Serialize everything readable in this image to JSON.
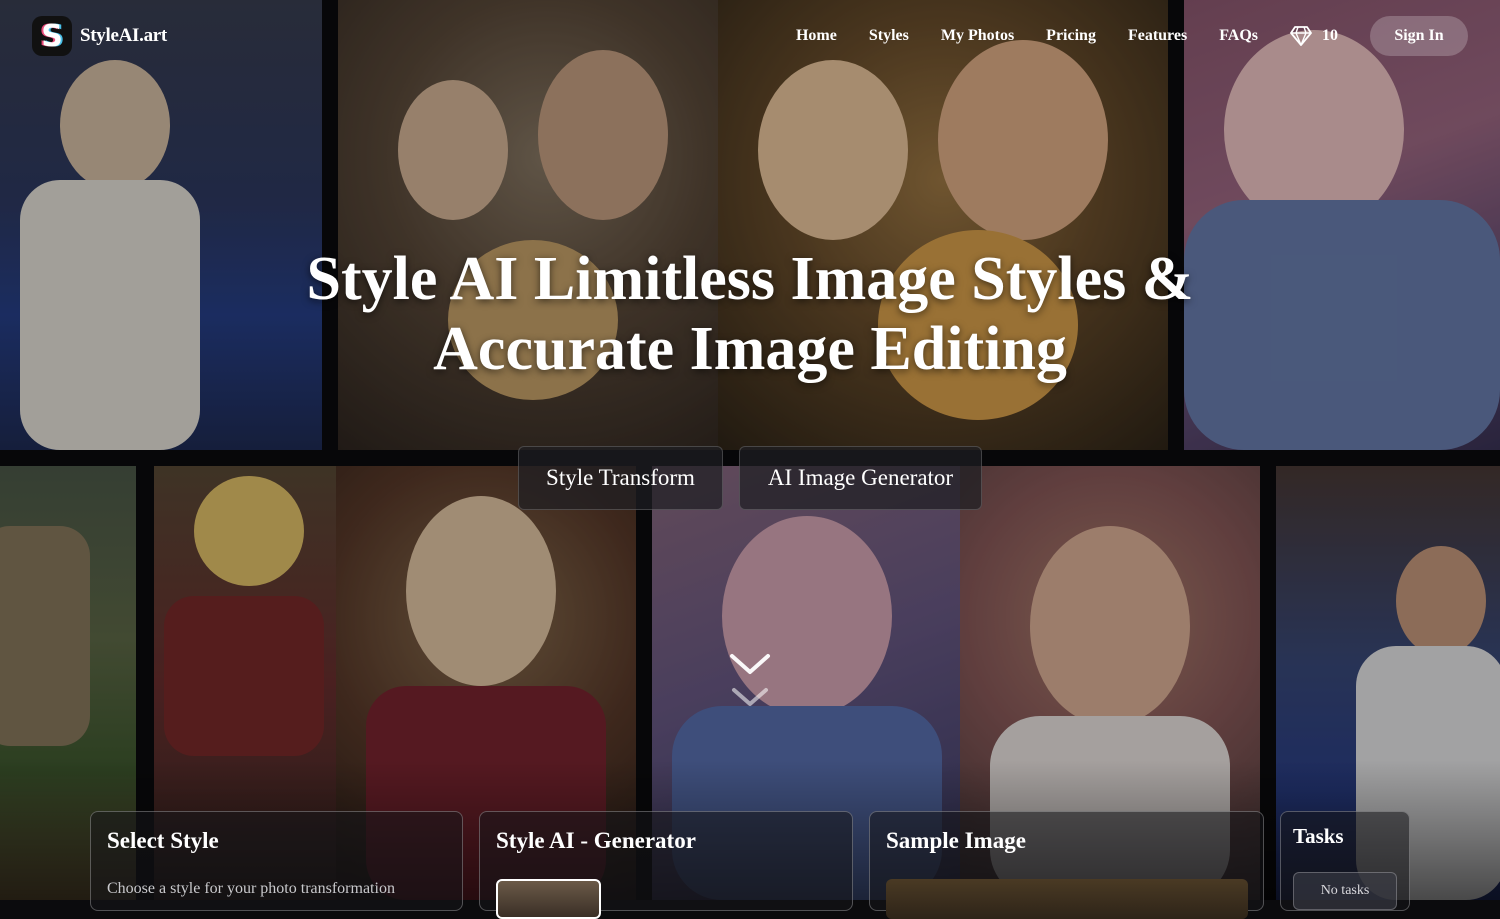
{
  "brand": {
    "name": "StyleAI.art",
    "logo_letter": "S"
  },
  "nav": {
    "items": [
      {
        "label": "Home"
      },
      {
        "label": "Styles"
      },
      {
        "label": "My Photos"
      },
      {
        "label": "Pricing"
      },
      {
        "label": "Features"
      },
      {
        "label": "FAQs"
      }
    ],
    "credits": "10",
    "sign_in": "Sign In"
  },
  "hero": {
    "title_line1": "Style AI Limitless Image Styles &",
    "title_line2": "Accurate Image Editing",
    "tabs": [
      {
        "label": "Style Transform"
      },
      {
        "label": "AI Image Generator"
      }
    ]
  },
  "panels": {
    "select_style": {
      "title": "Select Style",
      "subtitle": "Choose a style for your photo transformation"
    },
    "generator": {
      "title": "Style AI - Generator"
    },
    "sample": {
      "title": "Sample Image"
    },
    "tasks": {
      "title": "Tasks",
      "empty": "No tasks"
    }
  },
  "colors": {
    "accent": "#ffffff",
    "signin_bg": "rgba(255,255,255,0.22)"
  }
}
